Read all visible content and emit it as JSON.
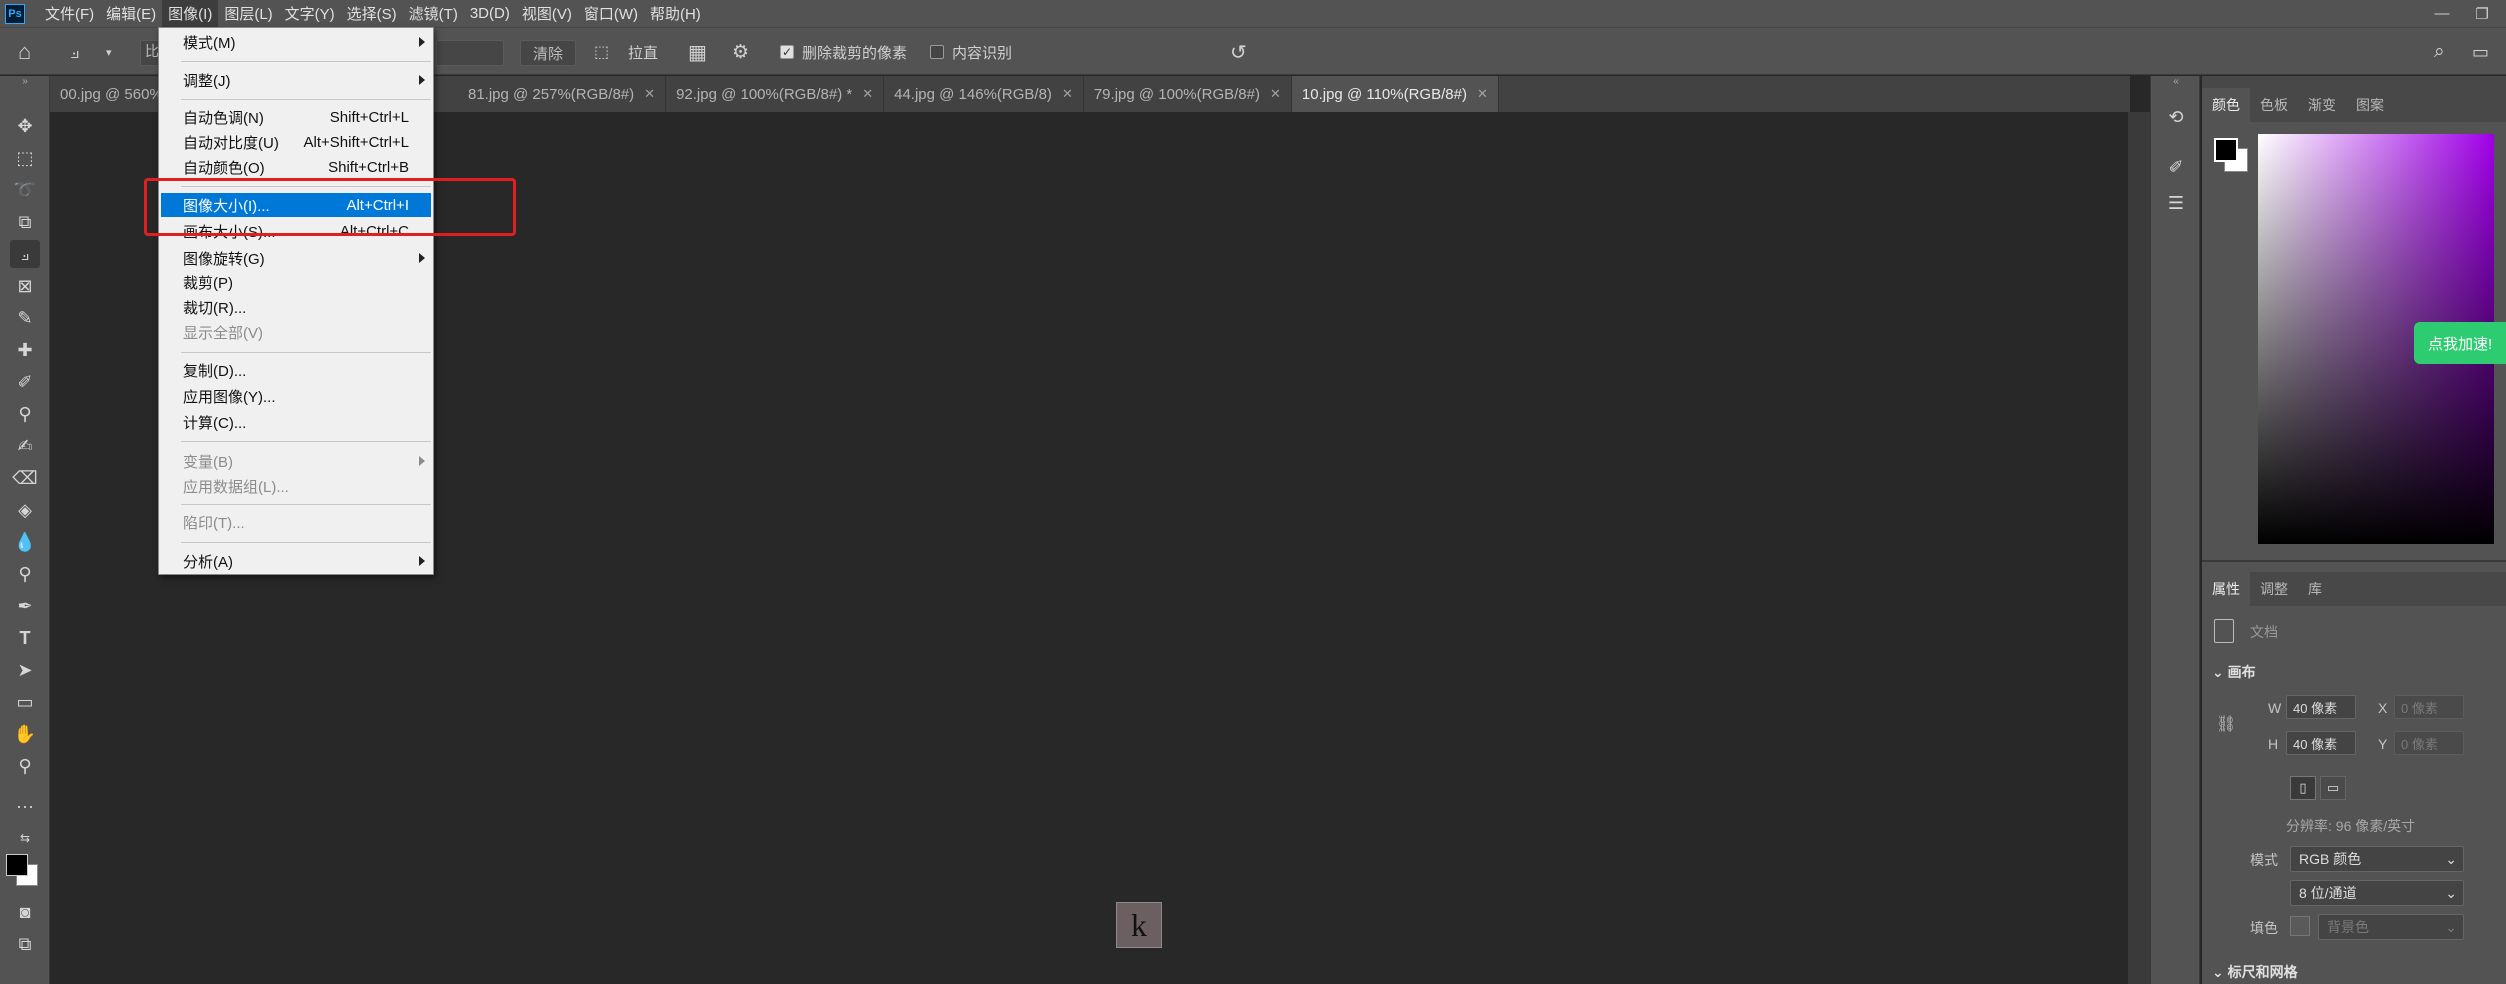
{
  "menubar": {
    "logo": "Ps",
    "items": [
      "文件(F)",
      "编辑(E)",
      "图像(I)",
      "图层(L)",
      "文字(Y)",
      "选择(S)",
      "滤镜(T)",
      "3D(D)",
      "视图(V)",
      "窗口(W)",
      "帮助(H)"
    ],
    "active_index": 2
  },
  "options": {
    "clear_label": "清除",
    "straighten_label": "拉直",
    "delete_cropped_label": "删除裁剪的像素",
    "delete_cropped_checked": true,
    "content_aware_label": "内容识别",
    "content_aware_checked": false,
    "ratio_partial": "比"
  },
  "tabs": [
    {
      "label": "00.jpg @ 560%",
      "active": false
    },
    {
      "label": "81.jpg @ 257%(RGB/8#)",
      "active": false
    },
    {
      "label": "92.jpg @ 100%(RGB/8#) *",
      "active": false
    },
    {
      "label": "44.jpg @ 146%(RGB/8)",
      "active": false
    },
    {
      "label": "79.jpg @ 100%(RGB/8#)",
      "active": false
    },
    {
      "label": "10.jpg @ 110%(RGB/8#)",
      "active": true
    }
  ],
  "dropdown": {
    "items": {
      "mode": {
        "label": "模式(M)"
      },
      "adjust": {
        "label": "调整(J)"
      },
      "auto_tone": {
        "label": "自动色调(N)",
        "shortcut": "Shift+Ctrl+L"
      },
      "auto_contrast": {
        "label": "自动对比度(U)",
        "shortcut": "Alt+Shift+Ctrl+L"
      },
      "auto_color": {
        "label": "自动颜色(O)",
        "shortcut": "Shift+Ctrl+B"
      },
      "image_size": {
        "label": "图像大小(I)...",
        "shortcut": "Alt+Ctrl+I"
      },
      "canvas_size": {
        "label": "画布大小(S)...",
        "shortcut": "Alt+Ctrl+C"
      },
      "image_rotation": {
        "label": "图像旋转(G)"
      },
      "crop": {
        "label": "裁剪(P)"
      },
      "trim": {
        "label": "裁切(R)..."
      },
      "reveal_all": {
        "label": "显示全部(V)"
      },
      "duplicate": {
        "label": "复制(D)..."
      },
      "apply_image": {
        "label": "应用图像(Y)..."
      },
      "calculations": {
        "label": "计算(C)..."
      },
      "variables": {
        "label": "变量(B)"
      },
      "apply_dataset": {
        "label": "应用数据组(L)..."
      },
      "trap": {
        "label": "陷印(T)..."
      },
      "analysis": {
        "label": "分析(A)"
      }
    }
  },
  "canvas": {
    "glyph": "k"
  },
  "color_panel": {
    "tabs": [
      "颜色",
      "色板",
      "渐变",
      "图案"
    ],
    "fg_color": "#000000",
    "bg_color": "#ffffff"
  },
  "speed_button": "点我加速!",
  "properties": {
    "tabs": [
      "属性",
      "调整",
      "库"
    ],
    "doc_label": "文档",
    "canvas_section": "画布",
    "w_label": "W",
    "w_value": "40 像素",
    "h_label": "H",
    "h_value": "40 像素",
    "x_label": "X",
    "x_value": "0 像素",
    "y_label": "Y",
    "y_value": "0 像素",
    "resolution": "分辨率: 96 像素/英寸",
    "mode_label": "模式",
    "mode_value": "RGB 颜色",
    "depth_value": "8 位/通道",
    "fill_label": "填色",
    "fill_value": "背景色",
    "rulers_section": "标尺和网格"
  }
}
